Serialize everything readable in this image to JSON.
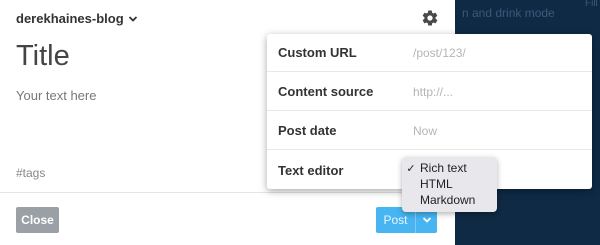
{
  "background": {
    "color": "#0f2a44",
    "partial_text": "n and drink mode",
    "corner_text": "Fill"
  },
  "post": {
    "blog_name": "derekhaines-blog",
    "title_placeholder": "Title",
    "body_placeholder": "Your text here",
    "tags_placeholder": "#tags"
  },
  "footer": {
    "close_label": "Close",
    "post_label": "Post"
  },
  "settings": {
    "rows": [
      {
        "label": "Custom URL",
        "placeholder": "/post/123/"
      },
      {
        "label": "Content source",
        "placeholder": "http://..."
      },
      {
        "label": "Post date",
        "placeholder": "Now"
      },
      {
        "label": "Text editor"
      }
    ]
  },
  "editor_menu": {
    "selected": "Rich text",
    "options": [
      "Rich text",
      "HTML",
      "Markdown"
    ]
  },
  "colors": {
    "post_button": "#47b5f1",
    "close_button": "#9aa0a6"
  }
}
